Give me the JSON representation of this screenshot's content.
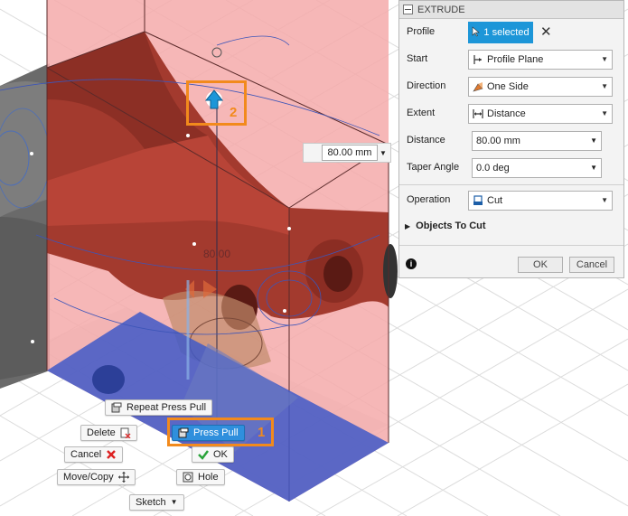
{
  "dimension": {
    "value": "80.00 mm",
    "label": "80.00"
  },
  "callouts": {
    "one": "1",
    "two": "2"
  },
  "marking_menu": {
    "repeat_press_pull": "Repeat Press Pull",
    "delete": "Delete",
    "press_pull": "Press Pull",
    "cancel": "Cancel",
    "ok": "OK",
    "move_copy": "Move/Copy",
    "hole": "Hole",
    "sketch": "Sketch"
  },
  "panel": {
    "title": "EXTRUDE",
    "profile": {
      "label": "Profile",
      "value": "1 selected"
    },
    "start": {
      "label": "Start",
      "value": "Profile Plane"
    },
    "direction": {
      "label": "Direction",
      "value": "One Side"
    },
    "extent": {
      "label": "Extent",
      "value": "Distance"
    },
    "distance": {
      "label": "Distance",
      "value": "80.00 mm"
    },
    "taper": {
      "label": "Taper Angle",
      "value": "0.0 deg"
    },
    "operation": {
      "label": "Operation",
      "value": "Cut"
    },
    "objects_to_cut": "Objects To Cut",
    "ok": "OK",
    "cancel": "Cancel"
  },
  "colors": {
    "accent": "#1d96d8",
    "callout": "#f28a1c",
    "cut_body": "#f29a9a",
    "profile": "#3f59c8"
  }
}
